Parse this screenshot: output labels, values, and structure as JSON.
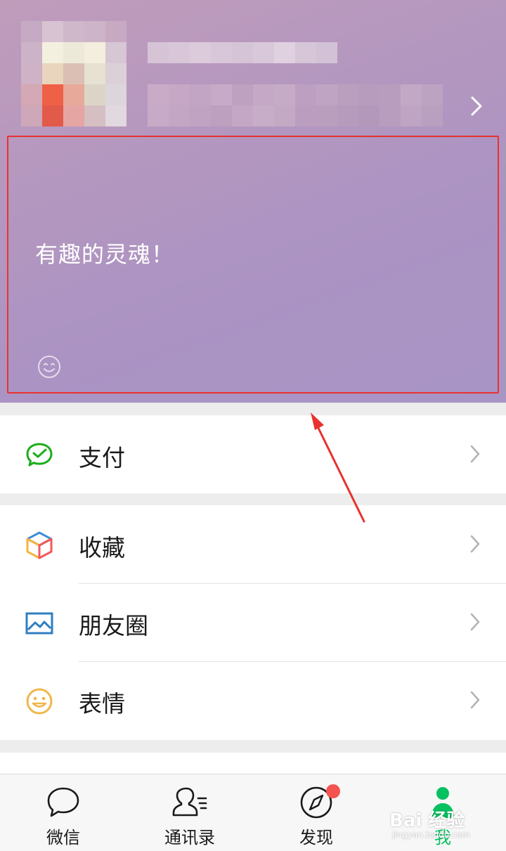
{
  "profile": {
    "status_text": "有趣的灵魂！",
    "status_icon": "smile-icon",
    "header_chevron_icon": "chevron-right-icon"
  },
  "menu": {
    "group1": [
      {
        "label": "支付",
        "icon": "pay-check-icon",
        "color": "#1aad19"
      }
    ],
    "group2": [
      {
        "label": "收藏",
        "icon": "favorites-cube-icon",
        "color": "#f4b63f"
      },
      {
        "label": "朋友圈",
        "icon": "moments-image-icon",
        "color": "#2f7ec2"
      },
      {
        "label": "表情",
        "icon": "sticker-smile-icon",
        "color": "#f0b74b"
      }
    ]
  },
  "tabbar": {
    "tabs": [
      {
        "label": "微信",
        "icon": "chat-bubble-icon"
      },
      {
        "label": "通讯录",
        "icon": "contacts-icon"
      },
      {
        "label": "发现",
        "icon": "compass-icon",
        "badge": true
      },
      {
        "label": "我",
        "icon": "me-person-icon",
        "active": true
      }
    ],
    "active_color": "#07c160"
  },
  "watermark": {
    "main": "Bai  经验",
    "sub": "jingyan.baidu.com"
  },
  "colors": {
    "highlight_border": "#e8322f",
    "badge": "#f5534f"
  }
}
